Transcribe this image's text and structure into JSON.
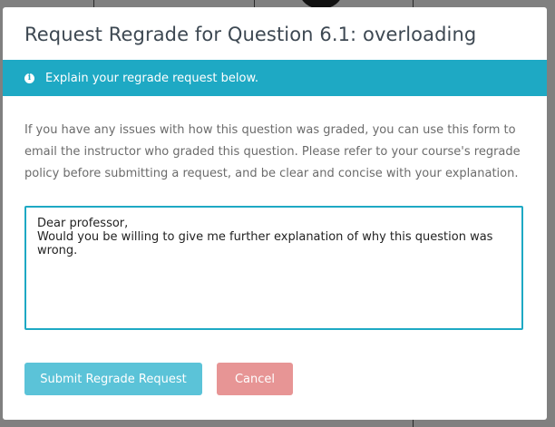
{
  "modal": {
    "title": "Request Regrade for Question 6.1: overloading",
    "alert": {
      "icon": "info-circle-icon",
      "text": "Explain your regrade request below."
    },
    "description": "If you have any issues with how this question was graded, you can use this form to email the instructor who graded this question. Please refer to your course's regrade policy before submitting a request, and be clear and concise with your explanation.",
    "request_text": "Dear professor,\nWould you be willing to give me further explanation of why this question was wrong.",
    "buttons": {
      "submit_label": "Submit Regrade Request",
      "cancel_label": "Cancel"
    }
  },
  "colors": {
    "accent": "#1ea9c4",
    "submit": "#5bc3d8",
    "cancel": "#e79595",
    "overlay": "#808080"
  }
}
